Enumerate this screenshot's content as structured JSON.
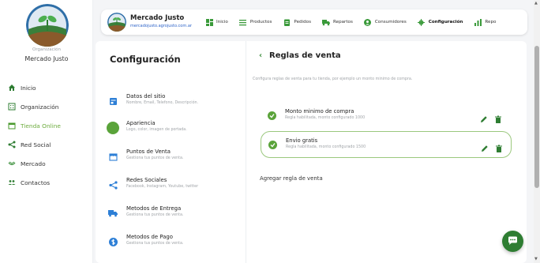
{
  "org": {
    "caption": "Organización",
    "name": "Mercado Justo"
  },
  "sidebar": {
    "items": [
      {
        "label": "Inicio",
        "icon": "home-icon"
      },
      {
        "label": "Organización",
        "icon": "building-icon"
      },
      {
        "label": "Tienda Online",
        "icon": "store-icon",
        "active": true
      },
      {
        "label": "Red Social",
        "icon": "share-icon"
      },
      {
        "label": "Mercado",
        "icon": "market-icon"
      },
      {
        "label": "Contactos",
        "icon": "contacts-icon"
      }
    ]
  },
  "brand": {
    "name": "Mercado Justo",
    "url": "mercadojusto.agrojusto.com.ar"
  },
  "topnav": {
    "items": [
      {
        "label": "Inicio",
        "icon": "dashboard-icon"
      },
      {
        "label": "Productos",
        "icon": "list-icon"
      },
      {
        "label": "Pedidos",
        "icon": "clipboard-icon"
      },
      {
        "label": "Repartos",
        "icon": "truck-icon"
      },
      {
        "label": "Consumidores",
        "icon": "user-circle-icon"
      },
      {
        "label": "Configuración",
        "icon": "gear-icon",
        "active": true
      },
      {
        "label": "Repo",
        "icon": "bar-chart-icon"
      }
    ]
  },
  "config": {
    "title": "Configuración",
    "menu": [
      {
        "title": "Datos del sitio",
        "subtitle": "Nombre, Email, Telefono, Descripción.",
        "icon": "site-data-icon"
      },
      {
        "title": "Apariencia",
        "subtitle": "Logo, color, imagen de portada.",
        "icon": "appearance-color-icon"
      },
      {
        "title": "Puntos de Venta",
        "subtitle": "Gestiona tus puntos de venta.",
        "icon": "storefront-icon"
      },
      {
        "title": "Redes Sociales",
        "subtitle": "Facebook, Instagram, Youtube, twitter",
        "icon": "share-icon"
      },
      {
        "title": "Metodos de Entrega",
        "subtitle": "Gestiona tus puntos de venta.",
        "icon": "truck-icon"
      },
      {
        "title": "Metodos de Pago",
        "subtitle": "Gestiona tus puntos de venta.",
        "icon": "dollar-icon"
      }
    ]
  },
  "rules": {
    "back": "‹",
    "title": "Reglas de venta",
    "description": "Configura reglas de venta para tu tienda, por ejemplo un monto minimo de compra.",
    "items": [
      {
        "name": "Monto minimo de compra",
        "subtitle": "Regla habilitada, monto configurado 1000"
      },
      {
        "name": "Envio gratis",
        "subtitle": "Regla habilitada, monto configurado 1500"
      }
    ],
    "add_label": "Agregar regla de venta"
  },
  "colors": {
    "accent": "#6cab3d",
    "check": "#5aa33a",
    "fab": "#2e7d32",
    "link": "#2d63c8"
  }
}
